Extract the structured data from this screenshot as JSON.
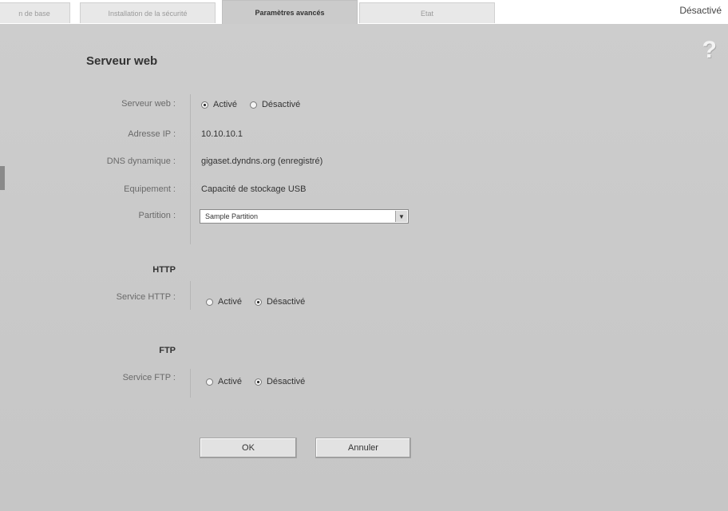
{
  "tabs": [
    {
      "label": "n de base"
    },
    {
      "label": "Installation de la sécurité"
    },
    {
      "label": "Paramètres avancés"
    },
    {
      "label": "Etat"
    }
  ],
  "header": {
    "status": "Désactivé"
  },
  "help": {
    "glyph": "?"
  },
  "page": {
    "title": "Serveur web"
  },
  "form": {
    "web_server": {
      "label": "Serveur web :",
      "on": "Activé",
      "off": "Désactivé",
      "selected": "Activé"
    },
    "ip": {
      "label": "Adresse IP :",
      "value": "10.10.10.1"
    },
    "ddns": {
      "label": "DNS dynamique :",
      "value": "gigaset.dyndns.org (enregistré)"
    },
    "device": {
      "label": "Equipement :",
      "value": "Capacité de stockage USB"
    },
    "partition": {
      "label": "Partition :",
      "value": "Sample Partition"
    }
  },
  "http": {
    "heading": "HTTP",
    "label": "Service HTTP :",
    "on": "Activé",
    "off": "Désactivé",
    "selected": "Désactivé"
  },
  "ftp": {
    "heading": "FTP",
    "label": "Service FTP :",
    "on": "Activé",
    "off": "Désactivé",
    "selected": "Désactivé"
  },
  "buttons": {
    "ok": "OK",
    "cancel": "Annuler"
  },
  "colors": {
    "panel": "#c8c8c8",
    "tab_active": "#cbcbcb",
    "tab_inactive": "#e8e8e8"
  }
}
